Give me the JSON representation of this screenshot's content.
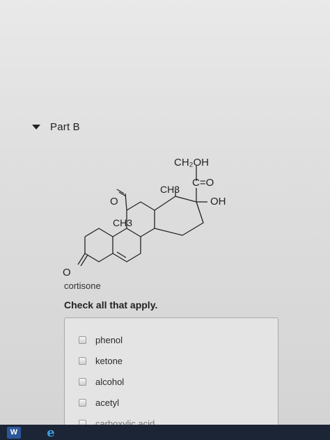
{
  "part": {
    "title": "Part B"
  },
  "molecule": {
    "name": "cortisone",
    "labels": {
      "ch2oh": "CH₂OH",
      "co": "C=O",
      "ch3_top": "CH3",
      "oh": "OH",
      "ch3_mid": "CH3",
      "o_top": "O",
      "o_left": "O"
    }
  },
  "question": {
    "instruction": "Check all that apply."
  },
  "options": [
    {
      "label": "phenol",
      "checked": false
    },
    {
      "label": "ketone",
      "checked": false
    },
    {
      "label": "alcohol",
      "checked": false
    },
    {
      "label": "acetyl",
      "checked": false
    },
    {
      "label": "carboxylic acid",
      "checked": false
    }
  ],
  "taskbar": {
    "word_glyph": "W",
    "ie_glyph": "e"
  }
}
